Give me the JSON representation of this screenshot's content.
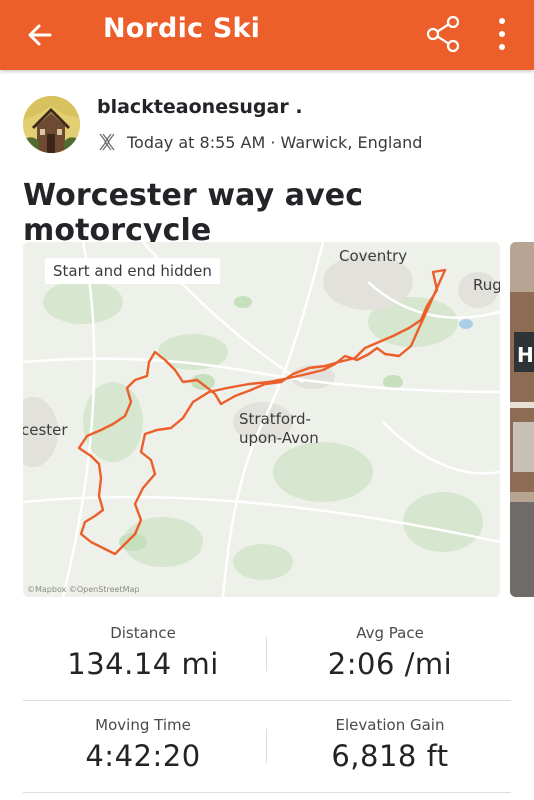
{
  "appbar": {
    "title": "Nordic Ski"
  },
  "author": {
    "name": "blackteaonesugar .",
    "meta": "Today at 8:55 AM · Warwick, England"
  },
  "activity": {
    "title": "Worcester way avec motorcycle"
  },
  "map": {
    "privacy_badge": "Start and end hidden",
    "places": {
      "coventry": "Coventry",
      "rugby": "Rug",
      "stratford_1": "Stratford-",
      "stratford_2": "upon-Avon",
      "worcester": "cester"
    },
    "credit": "©Mapbox ©OpenStreetMap",
    "route_color": "#ec5f2a"
  },
  "stats": [
    {
      "label": "Distance",
      "value": "134.14 mi"
    },
    {
      "label": "Avg Pace",
      "value": "2:06 /mi"
    },
    {
      "label": "Moving Time",
      "value": "4:42:20"
    },
    {
      "label": "Elevation Gain",
      "value": "6,818 ft"
    }
  ]
}
